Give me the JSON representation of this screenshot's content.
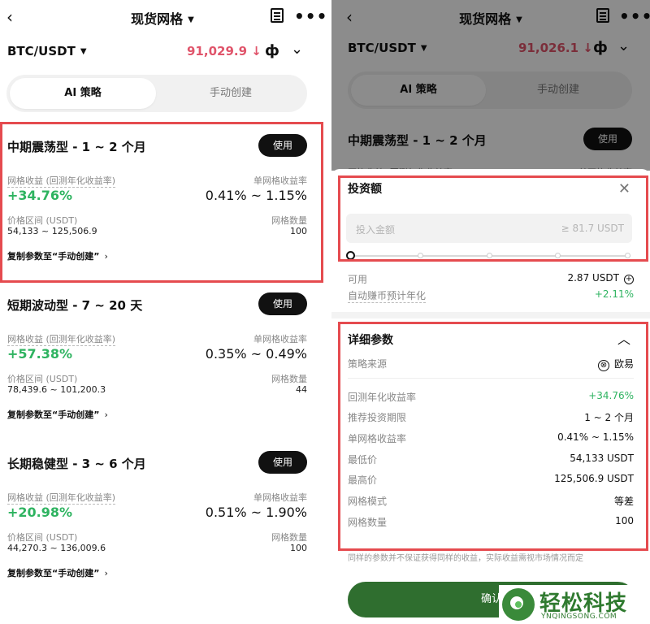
{
  "colors": {
    "accent_red": "#e0556b",
    "green": "#2eb360",
    "button_dark": "#111111",
    "highlight_box": "#e54b4f",
    "confirm_green": "#2f6e2f"
  },
  "left": {
    "header": {
      "title": "现货网格",
      "back_icon": "chevron-left-icon",
      "doc_icon": "document-icon",
      "more_icon": "more-icon"
    },
    "pair": {
      "symbol": "BTC/USDT",
      "price": "91,029.9 ↓",
      "chart_icon": "candlestick-icon"
    },
    "tabs": [
      "AI 策略",
      "手动创建"
    ],
    "cards": [
      {
        "title": "中期震荡型 - 1 ~ 2 个月",
        "use_label": "使用",
        "yield_label": "网格收益 (回测年化收益率)",
        "yield_value": "+34.76%",
        "per_grid_label": "单网格收益率",
        "per_grid_value": "0.41% ~ 1.15%",
        "range_label": "价格区间 (USDT)",
        "range_value": "54,133 ~ 125,506.9",
        "count_label": "网格数量",
        "count_value": "100",
        "copy_label": "复制参数至“手动创建”"
      },
      {
        "title": "短期波动型 - 7 ~ 20 天",
        "use_label": "使用",
        "yield_label": "网格收益 (回测年化收益率)",
        "yield_value": "+57.38%",
        "per_grid_label": "单网格收益率",
        "per_grid_value": "0.35% ~ 0.49%",
        "range_label": "价格区间 (USDT)",
        "range_value": "78,439.6 ~ 101,200.3",
        "count_label": "网格数量",
        "count_value": "44",
        "copy_label": "复制参数至“手动创建”"
      },
      {
        "title": "长期稳健型 - 3 ~ 6 个月",
        "use_label": "使用",
        "yield_label": "网格收益 (回测年化收益率)",
        "yield_value": "+20.98%",
        "per_grid_label": "单网格收益率",
        "per_grid_value": "0.51% ~ 1.90%",
        "range_label": "价格区间 (USDT)",
        "range_value": "44,270.3 ~ 136,009.6",
        "count_label": "网格数量",
        "count_value": "100",
        "copy_label": "复制参数至“手动创建”"
      }
    ]
  },
  "right": {
    "header": {
      "title": "现货网格"
    },
    "pair": {
      "symbol": "BTC/USDT",
      "price": "91,026.1 ↓"
    },
    "tabs": [
      "AI 策略",
      "手动创建"
    ],
    "bg_card": {
      "title": "中期震荡型 - 1 ~ 2 个月",
      "use_label": "使用",
      "yield_label": "网格收益 (回测年化收益率)",
      "per_grid_label": "单网格收益率"
    },
    "invest": {
      "title": "投资额",
      "placeholder": "投入金额",
      "min": "≥ 81.7 USDT",
      "available_label": "可用",
      "available_value": "2.87 USDT",
      "earn_label": "自动赚币预计年化",
      "earn_value": "+2.11%"
    },
    "details": {
      "title": "详细参数",
      "source_label": "策略来源",
      "source_value": "欧易",
      "rows": [
        {
          "k": "回测年化收益率",
          "v": "+34.76%"
        },
        {
          "k": "推荐投资期限",
          "v": "1 ~ 2 个月"
        },
        {
          "k": "单网格收益率",
          "v": "0.41% ~ 1.15%"
        },
        {
          "k": "最低价",
          "v": "54,133 USDT"
        },
        {
          "k": "最高价",
          "v": "125,506.9 USDT"
        },
        {
          "k": "网格模式",
          "v": "等差"
        },
        {
          "k": "网格数量",
          "v": "100"
        }
      ],
      "disclaimer": "同样的参数并不保证获得同样的收益，实际收益需视市场情况而定"
    },
    "confirm_label": "确认"
  },
  "watermark": {
    "text": "轻松科技",
    "url": "YNQINGSONG.COM"
  }
}
